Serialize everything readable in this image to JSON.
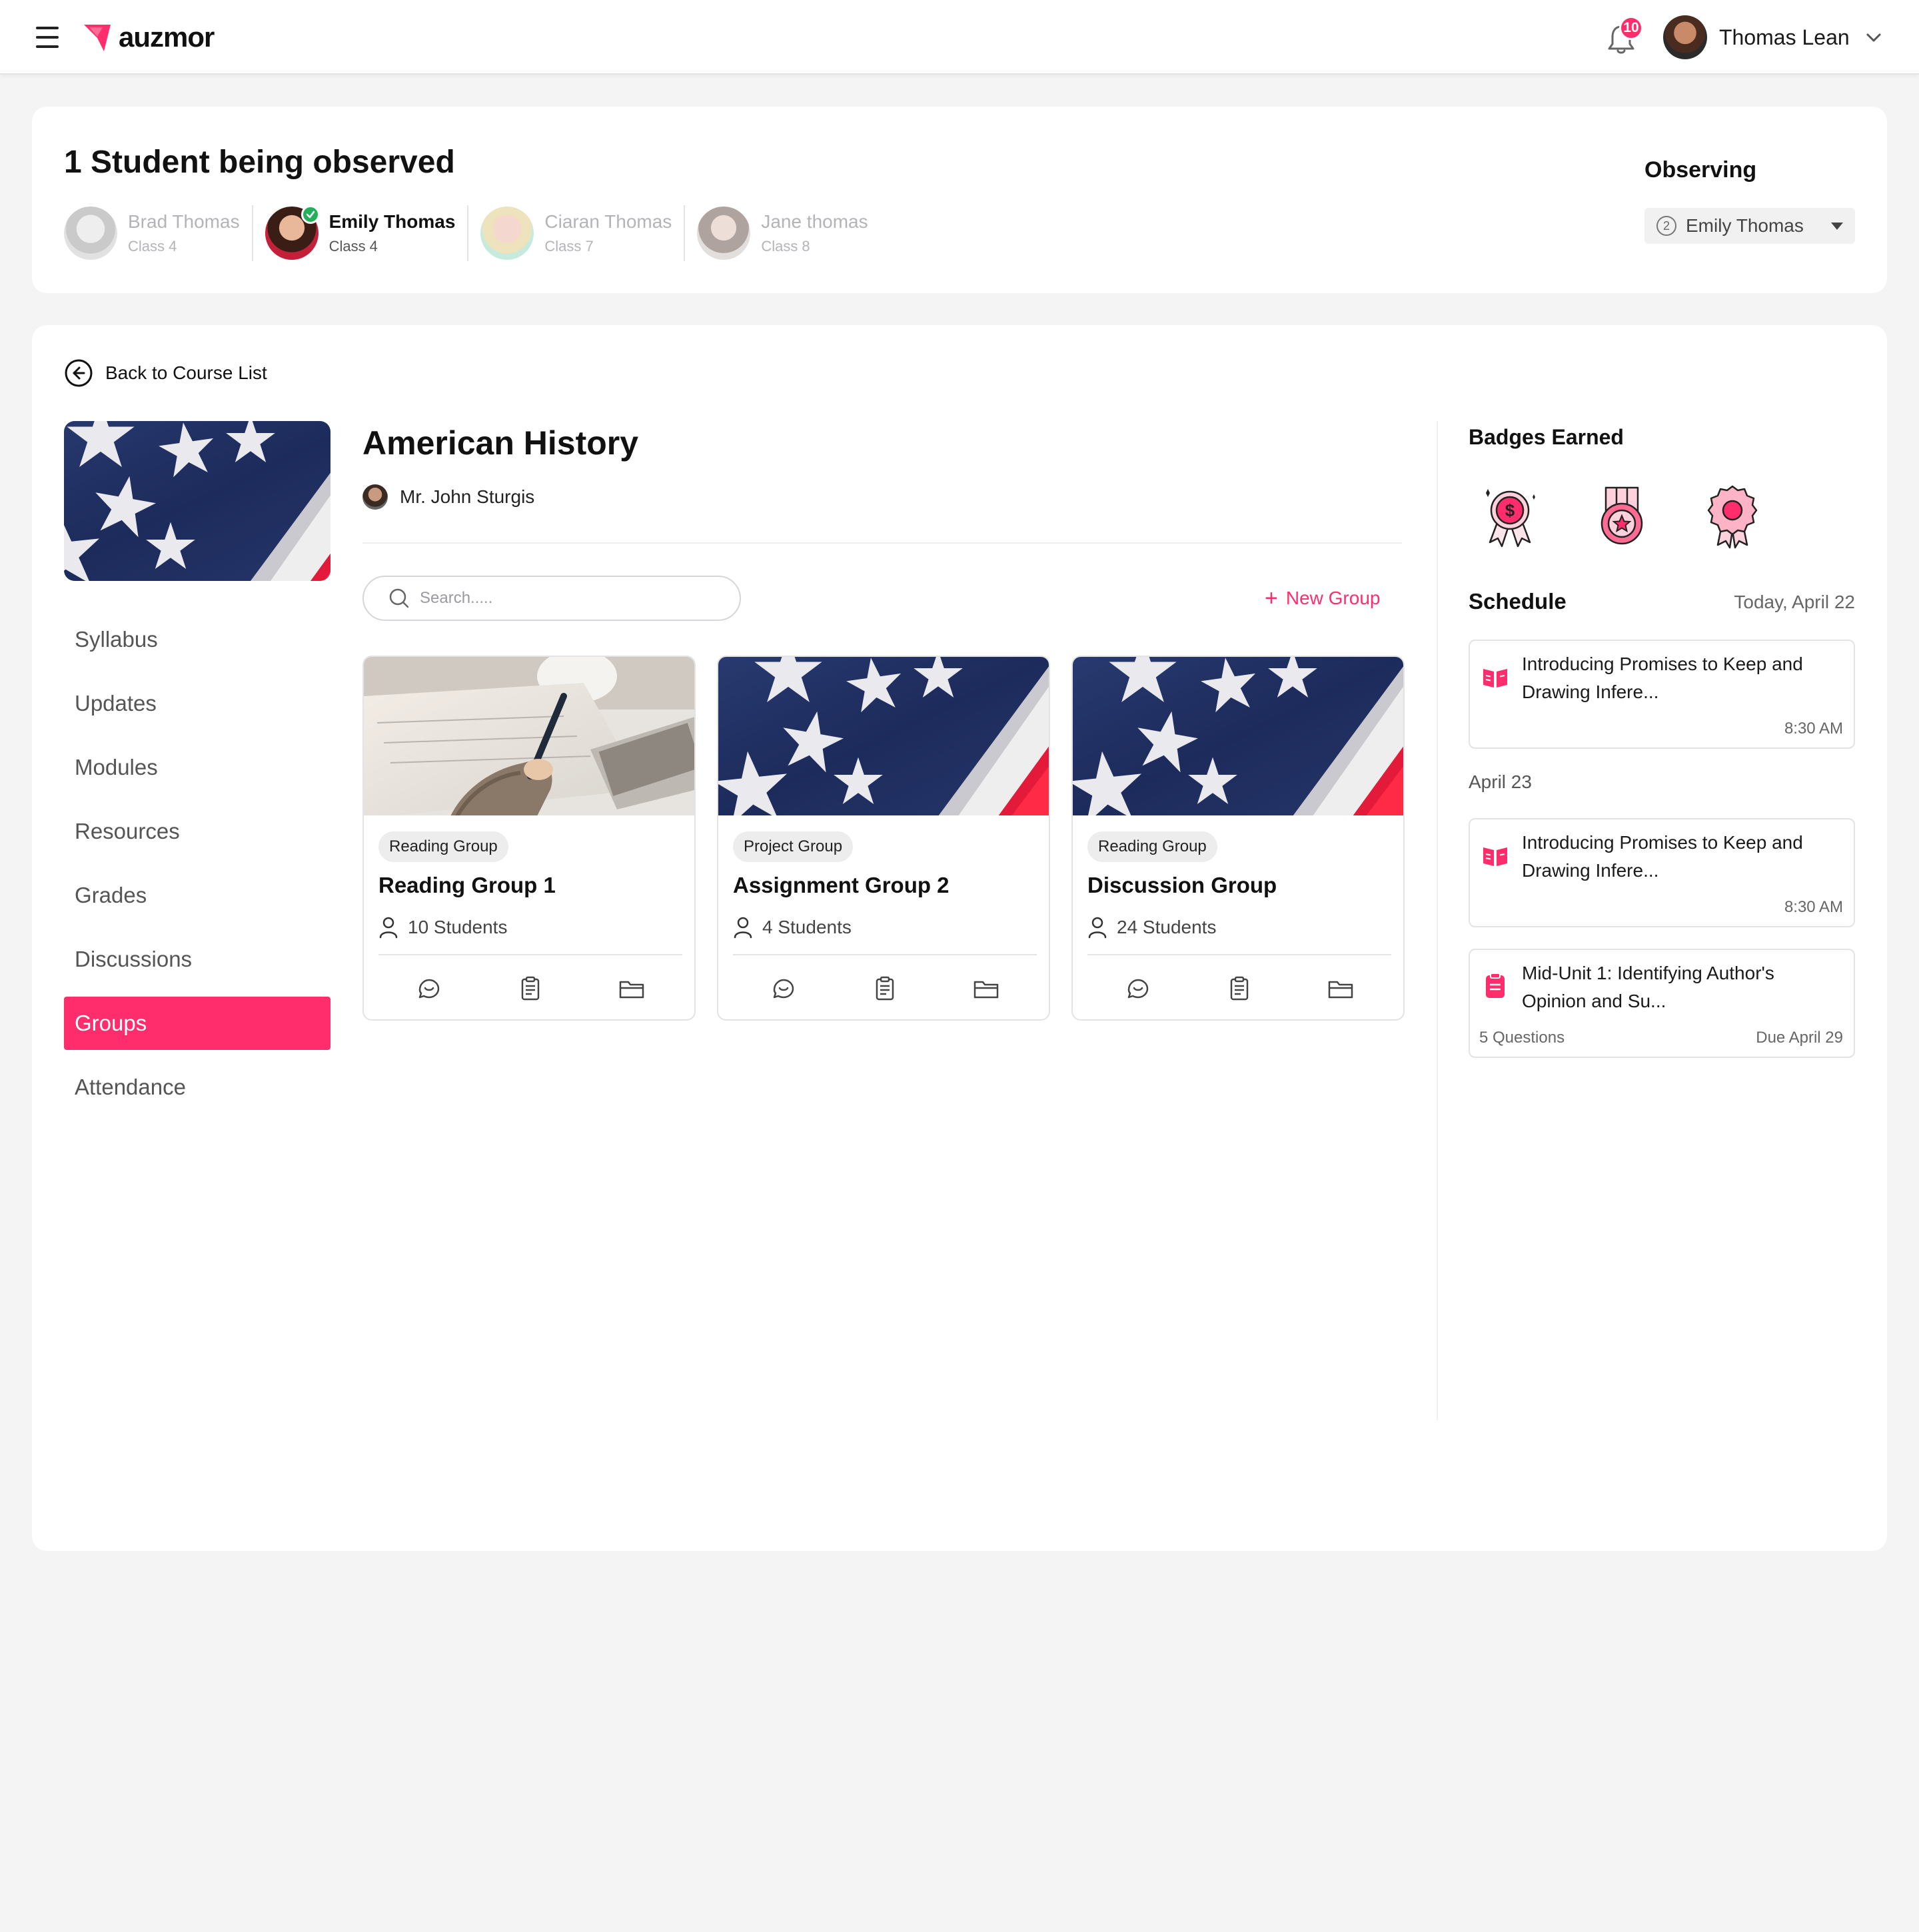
{
  "app": {
    "brand": "auzmor",
    "notifications_count": "10",
    "user_name": "Thomas Lean"
  },
  "observe": {
    "title": "1 Student being observed",
    "students": [
      {
        "name": "Brad Thomas",
        "class": "Class 4",
        "state": "dim"
      },
      {
        "name": "Emily Thomas",
        "class": "Class 4",
        "state": "active"
      },
      {
        "name": "Ciaran Thomas",
        "class": "Class 7",
        "state": "dim"
      },
      {
        "name": "Jane thomas",
        "class": "Class 8",
        "state": "dim"
      }
    ],
    "observing_label": "Observing",
    "observing_number": "2",
    "observing_value": "Emily Thomas"
  },
  "course": {
    "back_label": "Back to Course List",
    "title": "American History",
    "teacher": "Mr. John Sturgis",
    "nav": [
      "Syllabus",
      "Updates",
      "Modules",
      "Resources",
      "Grades",
      "Discussions",
      "Groups",
      "Attendance"
    ],
    "active_nav": "Groups"
  },
  "groups": {
    "search_placeholder": "Search.....",
    "new_group_label": "New Group",
    "cards": [
      {
        "tag": "Reading Group",
        "title": "Reading Group 1",
        "students": "10 Students",
        "image": "writing-photo"
      },
      {
        "tag": "Project Group",
        "title": "Assignment Group 2",
        "students": "4 Students",
        "image": "us-flag-photo"
      },
      {
        "tag": "Reading Group",
        "title": "Discussion Group",
        "students": "24 Students",
        "image": "us-flag-photo"
      }
    ]
  },
  "badges": {
    "title": "Badges Earned",
    "items": [
      "dollar-ribbon-badge-icon",
      "star-medal-badge-icon",
      "rosette-badge-icon"
    ]
  },
  "schedule": {
    "title": "Schedule",
    "today": "Today, April 22",
    "later_date": "April 23",
    "items": [
      {
        "icon": "book-icon",
        "title": "Introducing Promises to Keep and Drawing Infere...",
        "time": "8:30 AM"
      },
      {
        "icon": "book-icon",
        "title": "Introducing Promises to Keep and Drawing Infere...",
        "time": "8:30 AM"
      },
      {
        "icon": "clipboard-icon",
        "title": "Mid-Unit 1: Identifying Author's Opinion and Su...",
        "questions": "5 Questions",
        "due": "Due April 29"
      }
    ]
  },
  "colors": {
    "accent": "#ff2d6b",
    "background": "#f4f4f5",
    "success": "#22b15a"
  }
}
